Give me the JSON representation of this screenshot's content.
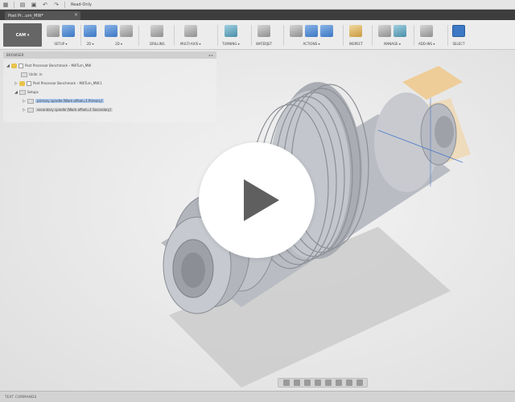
{
  "titlebar": {
    "read_only": "Read-Only"
  },
  "tab": {
    "title": "Post Pr...urn_MW*"
  },
  "ribbon": {
    "workspace": "CAM ▾",
    "groups": [
      {
        "label": "SETUP ▾"
      },
      {
        "label": "2D ▾"
      },
      {
        "label": "3D ▾"
      },
      {
        "label": "DRILLING"
      },
      {
        "label": "MULTI-AXIS ▾"
      },
      {
        "label": "TURNING ▾"
      },
      {
        "label": "WATERJET"
      },
      {
        "label": "ACTIONS ▾"
      },
      {
        "label": "INSPECT"
      },
      {
        "label": "MANAGE ▾"
      },
      {
        "label": "ADD-INS ▾"
      },
      {
        "label": "SELECT"
      }
    ]
  },
  "browser": {
    "header": "BROWSER",
    "items": [
      {
        "label": "Post Processor Benchmark – MillTurn_MW"
      },
      {
        "label": "Units: in"
      },
      {
        "label": "Post Processor Benchmark – MillTurn_MW:1"
      },
      {
        "label": "Setups"
      },
      {
        "label": "primary spindle [Work offset=1 Primary]"
      },
      {
        "label": "secondary spindle [Work offset=1 Secondary]"
      }
    ]
  },
  "footer": {
    "text_commands": "TEXT COMMANDS"
  },
  "overlay": {
    "play_icon": "play-icon"
  },
  "colors": {
    "accent": "#3c78c4",
    "dark_tab": "#3d3d3d",
    "selection": "#a9c8ef"
  }
}
